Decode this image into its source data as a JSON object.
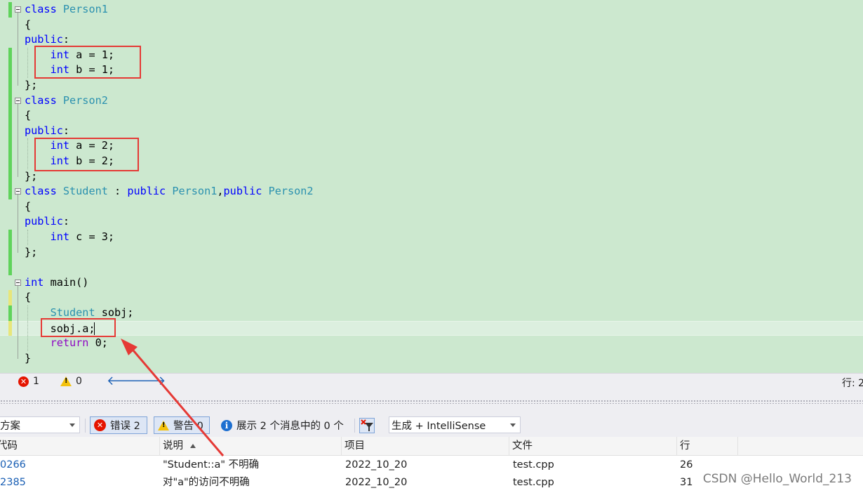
{
  "editor": {
    "lines": [
      [
        {
          "t": "class",
          "c": "kw"
        },
        {
          "t": " "
        },
        {
          "t": "Person1",
          "c": "ty"
        }
      ],
      [
        {
          "t": "{"
        }
      ],
      [
        {
          "t": "public",
          "c": "kw"
        },
        {
          "t": ":"
        }
      ],
      [
        {
          "t": "    "
        },
        {
          "t": "int",
          "c": "kw"
        },
        {
          "t": " a = 1;"
        }
      ],
      [
        {
          "t": "    "
        },
        {
          "t": "int",
          "c": "kw"
        },
        {
          "t": " b = 1;"
        }
      ],
      [
        {
          "t": "};"
        }
      ],
      [
        {
          "t": "class",
          "c": "kw"
        },
        {
          "t": " "
        },
        {
          "t": "Person2",
          "c": "ty"
        }
      ],
      [
        {
          "t": "{"
        }
      ],
      [
        {
          "t": "public",
          "c": "kw"
        },
        {
          "t": ":"
        }
      ],
      [
        {
          "t": "    "
        },
        {
          "t": "int",
          "c": "kw"
        },
        {
          "t": " a = 2;"
        }
      ],
      [
        {
          "t": "    "
        },
        {
          "t": "int",
          "c": "kw"
        },
        {
          "t": " b = 2;"
        }
      ],
      [
        {
          "t": "};"
        }
      ],
      [
        {
          "t": "class",
          "c": "kw"
        },
        {
          "t": " "
        },
        {
          "t": "Student",
          "c": "ty"
        },
        {
          "t": " : "
        },
        {
          "t": "public",
          "c": "kw"
        },
        {
          "t": " "
        },
        {
          "t": "Person1",
          "c": "ty"
        },
        {
          "t": ","
        },
        {
          "t": "public",
          "c": "kw"
        },
        {
          "t": " "
        },
        {
          "t": "Person2",
          "c": "ty"
        }
      ],
      [
        {
          "t": "{"
        }
      ],
      [
        {
          "t": "public",
          "c": "kw"
        },
        {
          "t": ":"
        }
      ],
      [
        {
          "t": "    "
        },
        {
          "t": "int",
          "c": "kw"
        },
        {
          "t": " c = 3;"
        }
      ],
      [
        {
          "t": "};"
        }
      ],
      [],
      [
        {
          "t": "int",
          "c": "kw"
        },
        {
          "t": " main()"
        }
      ],
      [
        {
          "t": "{"
        }
      ],
      [
        {
          "t": "    "
        },
        {
          "t": "Student",
          "c": "ty"
        },
        {
          "t": " sobj;"
        }
      ],
      [
        {
          "t": "    sobj.a;"
        }
      ],
      [
        {
          "t": "    "
        },
        {
          "t": "return",
          "c": "ct"
        },
        {
          "t": " 0;"
        }
      ],
      [
        {
          "t": "}"
        }
      ]
    ]
  },
  "status_strip": {
    "errors": "1",
    "warnings": "0",
    "position": "行: 2"
  },
  "toolbar": {
    "scope_value": "方案",
    "errors_button": "错误 2",
    "warnings_button": "警告 0",
    "messages_text": "展示 2 个消息中的 0 个",
    "build_filter_value": "生成 + IntelliSense"
  },
  "grid": {
    "headers": {
      "code": "代码",
      "description": "说明",
      "project": "项目",
      "file": "文件",
      "line": "行"
    },
    "rows": [
      {
        "code": "0266",
        "description": "\"Student::a\" 不明确",
        "project": "2022_10_20",
        "file": "test.cpp",
        "line": "26"
      },
      {
        "code": "2385",
        "description": "对\"a\"的访问不明确",
        "project": "2022_10_20",
        "file": "test.cpp",
        "line": "31"
      }
    ]
  },
  "watermark": "CSDN @Hello_World_213",
  "colors": {
    "editor_bg": "#cce8cf",
    "keyword": "#0000ff",
    "type": "#2b91af",
    "control": "#8f08c4",
    "highlight_box": "#e53935",
    "change_saved": "#5fd35b",
    "change_unsaved": "#e8e67a"
  }
}
